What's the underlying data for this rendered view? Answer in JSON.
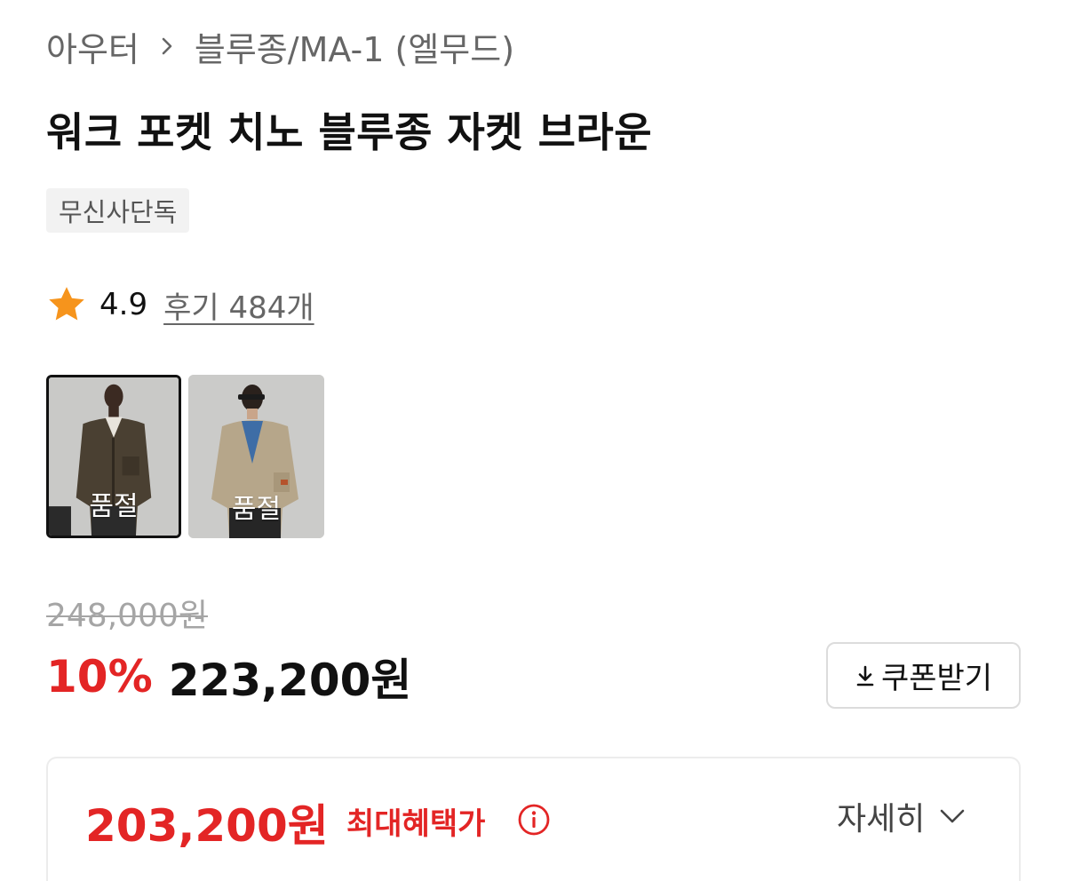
{
  "breadcrumb": {
    "items": [
      "아우터",
      "블루종/MA-1 (엘무드)"
    ]
  },
  "product": {
    "title": "워크 포켓 치노 블루종 자켓 브라운",
    "badge": "무신사단독",
    "rating": "4.9",
    "reviews_label": "후기 484개"
  },
  "thumbnails": [
    {
      "status": "품절",
      "selected": true,
      "colorway": "dark brown"
    },
    {
      "status": "품절",
      "selected": false,
      "colorway": "khaki beige"
    }
  ],
  "price": {
    "original": "248,000원",
    "discount": "10%",
    "sale": "223,200원"
  },
  "coupon": {
    "label": "쿠폰받기",
    "icon": "download-icon"
  },
  "benefit": {
    "price": "203,200원",
    "label": "최대혜택가",
    "info_icon": "info-icon",
    "detail_label": "자세히",
    "detail_icon": "chevron-down-icon"
  },
  "colors": {
    "accent_red": "#e32525",
    "star": "#f6941c",
    "muted": "#666666",
    "strike": "#a5a5a5"
  }
}
